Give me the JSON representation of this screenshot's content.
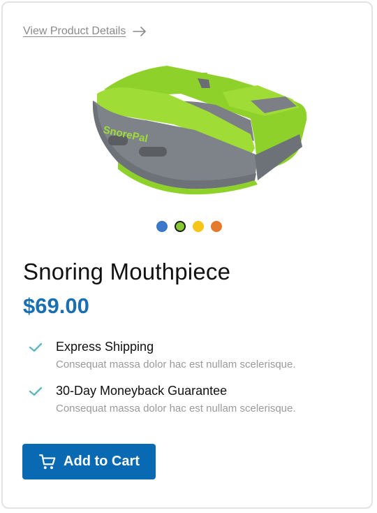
{
  "header": {
    "details_link": "View Product Details"
  },
  "product": {
    "image_alt": "SnorePal mouthpiece",
    "logo_text": "SnorePal",
    "name": "Snoring Mouthpiece",
    "price": "$69.00"
  },
  "swatches": [
    {
      "name": "blue",
      "color": "#3a78c9",
      "selected": false
    },
    {
      "name": "green",
      "color": "#86c82e",
      "selected": true
    },
    {
      "name": "yellow",
      "color": "#f5c518",
      "selected": false
    },
    {
      "name": "orange",
      "color": "#e47a30",
      "selected": false
    }
  ],
  "features": [
    {
      "title": "Express Shipping",
      "description": "Consequat massa dolor hac est nullam scelerisque."
    },
    {
      "title": "30-Day Moneyback Guarantee",
      "description": "Consequat massa dolor hac est nullam scelerisque."
    }
  ],
  "cta": {
    "label": "Add to Cart",
    "icon": "cart-icon"
  },
  "colors": {
    "accent": "#0a69b3",
    "price": "#1a6fb1",
    "check": "#5fb6c2"
  }
}
